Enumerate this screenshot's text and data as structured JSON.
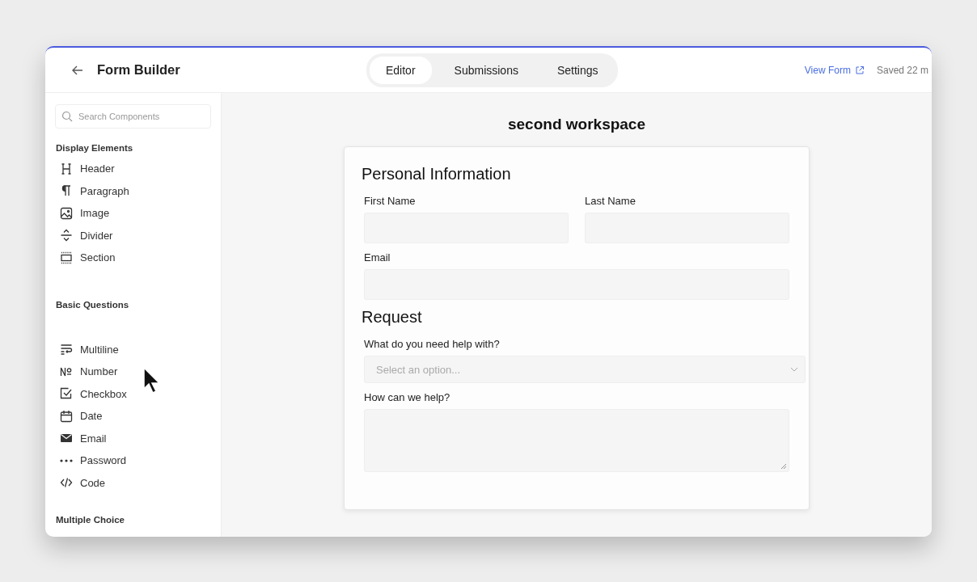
{
  "header": {
    "title": "Form Builder",
    "tabs": [
      {
        "label": "Editor",
        "selected": true
      },
      {
        "label": "Submissions",
        "selected": false
      },
      {
        "label": "Settings",
        "selected": false
      }
    ],
    "view_link": "View Form",
    "saved_status": "Saved 22 m"
  },
  "sidebar": {
    "search": {
      "placeholder": "Search Components"
    },
    "groups": [
      {
        "title": "Display Elements",
        "items": [
          {
            "label": "Header",
            "kind": "header"
          },
          {
            "label": "Paragraph",
            "kind": "paragraph"
          },
          {
            "label": "Image",
            "kind": "image"
          },
          {
            "label": "Divider",
            "kind": "divider"
          },
          {
            "label": "Section",
            "kind": "section"
          }
        ]
      },
      {
        "title": "Basic Questions",
        "items": [
          {
            "label": "Multiline",
            "kind": "multiline"
          },
          {
            "label": "Number",
            "kind": "number"
          },
          {
            "label": "Checkbox",
            "kind": "checkbox"
          },
          {
            "label": "Date",
            "kind": "date"
          },
          {
            "label": "Email",
            "kind": "email"
          },
          {
            "label": "Password",
            "kind": "password"
          },
          {
            "label": "Code",
            "kind": "code"
          }
        ]
      },
      {
        "title": "Multiple Choice"
      }
    ]
  },
  "canvas": {
    "title": "second workspace",
    "sections": [
      {
        "title": "Personal Information",
        "rows": [
          [
            {
              "label": "First Name",
              "kind": "text"
            },
            {
              "label": "Last Name",
              "kind": "text"
            }
          ],
          [
            {
              "label": "Email",
              "kind": "text"
            }
          ]
        ]
      },
      {
        "title": "Request",
        "rows": [
          [
            {
              "label": "What do you need help with?",
              "kind": "select",
              "placeholder": "Select an option..."
            }
          ],
          [
            {
              "label": "How can we help?",
              "kind": "textarea"
            }
          ]
        ]
      }
    ]
  }
}
